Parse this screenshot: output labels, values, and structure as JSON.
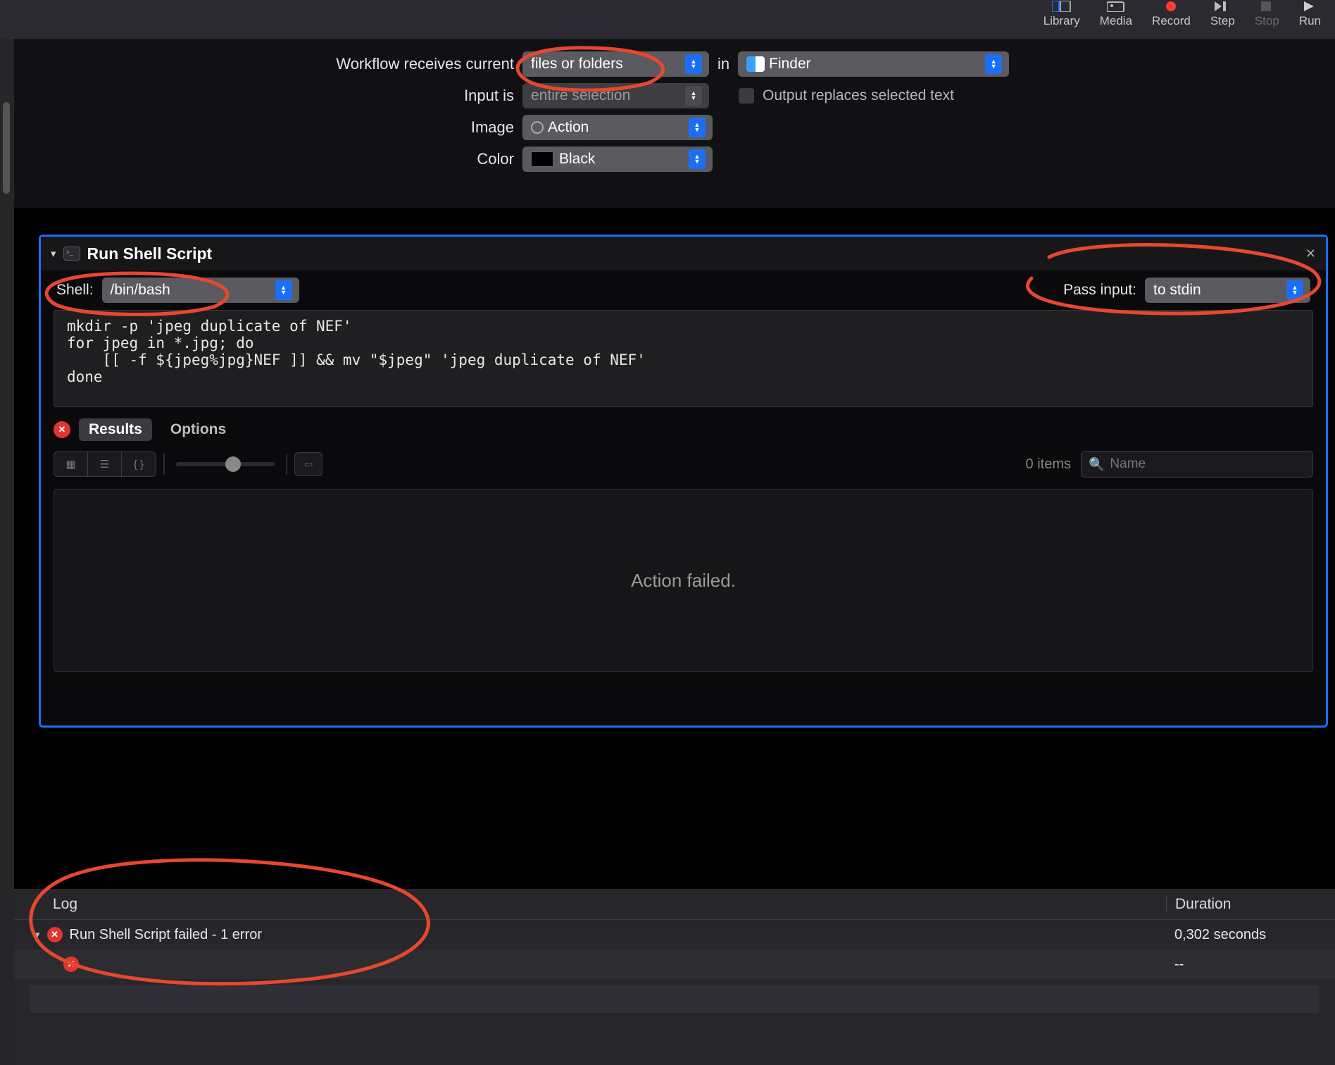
{
  "toolbar": {
    "library": "Library",
    "media": "Media",
    "record": "Record",
    "step": "Step",
    "stop": "Stop",
    "run": "Run"
  },
  "config": {
    "receives_label": "Workflow receives current",
    "receives_value": "files or folders",
    "in_label": "in",
    "finder_value": "Finder",
    "input_label": "Input is",
    "input_value": "entire selection",
    "output_replaces": "Output replaces selected text",
    "image_label": "Image",
    "image_value": "Action",
    "color_label": "Color",
    "color_value": "Black"
  },
  "action": {
    "title": "Run Shell Script",
    "shell_label": "Shell:",
    "shell_value": "/bin/bash",
    "passinput_label": "Pass input:",
    "passinput_value": "to stdin",
    "code": "mkdir -p 'jpeg duplicate of NEF'\nfor jpeg in *.jpg; do\n    [[ -f ${jpeg%jpg}NEF ]] && mv \"$jpeg\" 'jpeg duplicate of NEF'\ndone",
    "results_tab": "Results",
    "options_tab": "Options",
    "items_count": "0 items",
    "search_placeholder": "Name",
    "result_status": "Action failed."
  },
  "log": {
    "header": "Log",
    "duration_header": "Duration",
    "rows": [
      {
        "text": "Run Shell Script failed - 1 error",
        "duration": "0,302 seconds"
      },
      {
        "text": "",
        "duration": "--"
      }
    ]
  }
}
